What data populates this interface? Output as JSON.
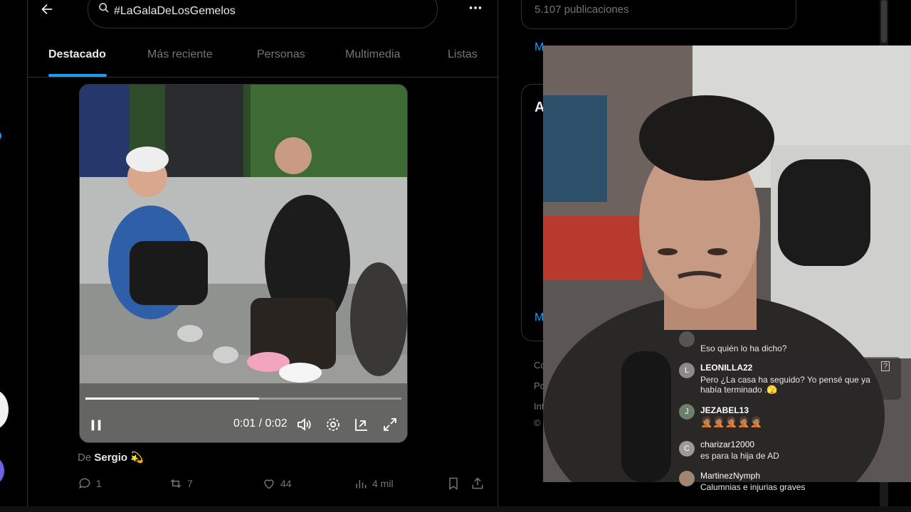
{
  "search": {
    "query": "#LaGalaDeLosGemelos"
  },
  "tabs": [
    {
      "label": "Destacado",
      "active": true
    },
    {
      "label": "Más reciente"
    },
    {
      "label": "Personas"
    },
    {
      "label": "Multimedia"
    },
    {
      "label": "Listas"
    }
  ],
  "video": {
    "time_current": "0:01",
    "time_separator": "/",
    "time_total": "0:02",
    "progress": 0.55,
    "state": "playing"
  },
  "post": {
    "credit_prefix": "De",
    "credit_name": "Sergio",
    "credit_emoji": "💫",
    "replies": "1",
    "reposts": "7",
    "likes": "44",
    "views": "4 mil"
  },
  "sidebar": {
    "publication_count": "5.107 publicaciones",
    "fragments": [
      "M",
      "A",
      "M",
      "Co",
      "Po",
      "Int",
      "©"
    ]
  },
  "chat": {
    "messages": [
      {
        "user": "",
        "text": "Eso quién lo ha dicho?",
        "avatar": ""
      },
      {
        "user": "LEONILLA22",
        "text": "Pero ¿La casa ha seguido? Yo pensé que ya había terminado .🫣",
        "avatar": "L"
      },
      {
        "user": "JEZABEL13",
        "text": "🤦🏽🤦🏽🤦🏽🤦🏽🤦🏽",
        "avatar": "J"
      },
      {
        "user": "charizar12000",
        "text": "es para la hija de AD",
        "avatar": "C"
      },
      {
        "user": "MartinezNymph",
        "text": "Calumnias e injurias graves",
        "avatar": ""
      }
    ]
  },
  "colors": {
    "accent": "#1d9bf0",
    "muted": "#71767b",
    "text": "#e7e9ea",
    "border": "#2f3336"
  }
}
